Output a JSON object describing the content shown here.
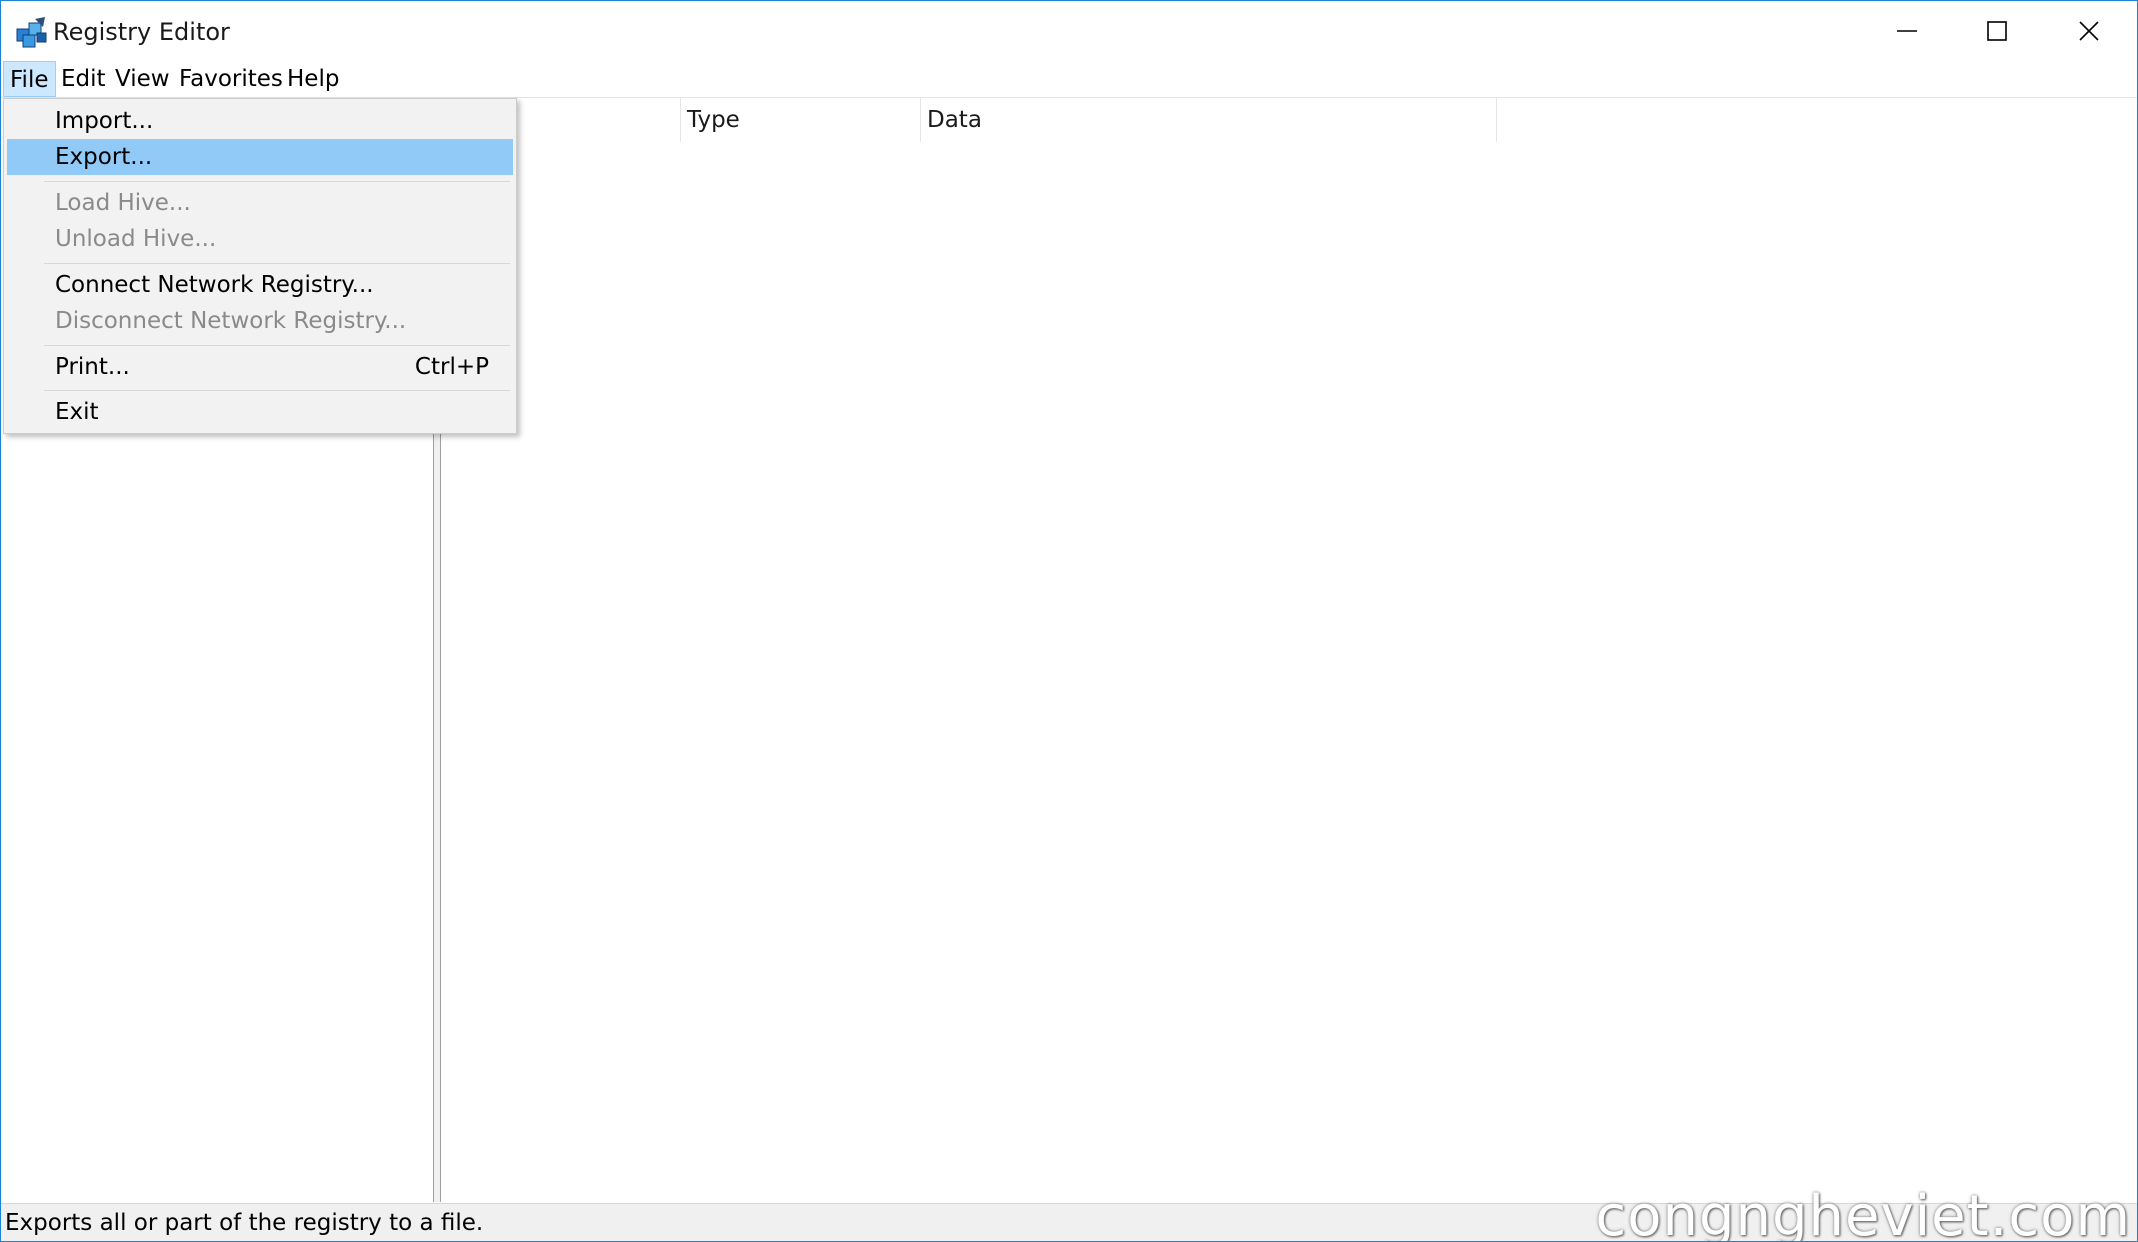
{
  "window": {
    "title": "Registry Editor",
    "icon": "registry-editor-icon",
    "border_color": "#1883d7"
  },
  "menubar": {
    "items": [
      {
        "label": "File",
        "active": true
      },
      {
        "label": "Edit"
      },
      {
        "label": "View"
      },
      {
        "label": "Favorites"
      },
      {
        "label": "Help"
      }
    ]
  },
  "file_menu": {
    "items": [
      {
        "label": "Import...",
        "enabled": true
      },
      {
        "label": "Export...",
        "enabled": true,
        "highlighted": true
      },
      {
        "label": "Load Hive...",
        "enabled": false
      },
      {
        "label": "Unload Hive...",
        "enabled": false
      },
      {
        "label": "Connect Network Registry...",
        "enabled": true
      },
      {
        "label": "Disconnect Network Registry...",
        "enabled": false
      },
      {
        "label": "Print...",
        "shortcut": "Ctrl+P",
        "enabled": true
      },
      {
        "label": "Exit",
        "enabled": true
      }
    ],
    "highlight_color": "#91c9f7"
  },
  "list": {
    "columns": [
      "",
      "Type",
      "Data"
    ]
  },
  "statusbar": {
    "text": "Exports all or part of the registry to a file."
  },
  "watermark": {
    "text": "congngheviet.com"
  }
}
